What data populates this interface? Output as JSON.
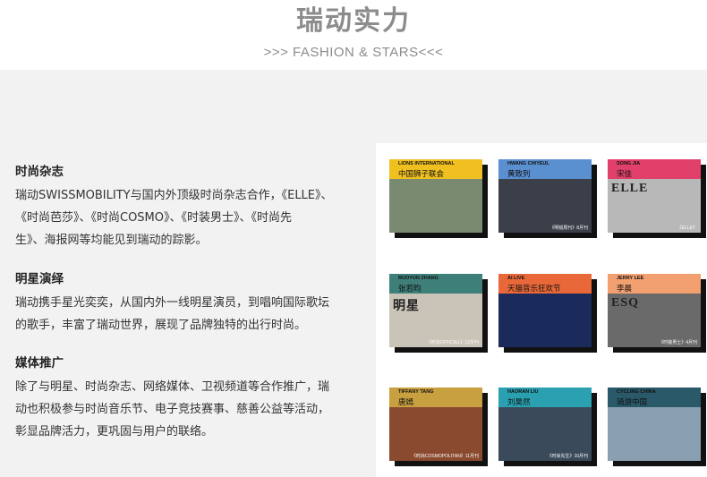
{
  "header": {
    "title": "瑞动实力",
    "subtitle": ">>>  FASHION & STARS<<<"
  },
  "sections": [
    {
      "heading": "时尚杂志",
      "lines": [
        "瑞动SWISSMOBILITY与国内外顶级时尚杂志合作，《ELLE》、",
        "《时尚芭莎》、《时尚COSMO》、《时装男士》、《时尚先",
        "生》、海报网等均能见到瑞动的踪影。"
      ]
    },
    {
      "heading": "明星演绎",
      "lines": [
        "瑞动携手星光奕奕，从国内外一线明星演员，到唱响国际歌坛",
        "的歌手，丰富了瑞动世界，展现了品牌独特的出行时尚。"
      ]
    },
    {
      "heading": "媒体推广",
      "lines": [
        "除了与明星、时尚杂志、网络媒体、卫视频道等合作推广，瑞",
        "动也积极参与时尚音乐节、电子竞技赛事、慈善公益等活动，",
        "彰显品牌活力，更巩固与用户的联络。"
      ]
    }
  ],
  "gallery": [
    {
      "en": "LIONS INTERNATIONAL",
      "cn": "中国狮子联会",
      "band_color": "#f0c020",
      "photo_color": "#7a8a70",
      "foot": "",
      "mag": ""
    },
    {
      "en": "HWANG CHIYEUL",
      "cn": "黄致列",
      "band_color": "#5a8fd0",
      "photo_color": "#3a3f4a",
      "foot": "《明锐周刊》8月刊",
      "mag": ""
    },
    {
      "en": "SONG JIA",
      "cn": "宋佳",
      "band_color": "#e0406a",
      "photo_color": "#b8b8b8",
      "foot": "《ELLE》",
      "mag": "ELLE"
    },
    {
      "en": "RUOYUN ZHANG",
      "cn": "张若昀",
      "band_color": "#3f7f7a",
      "photo_color": "#c9c3b8",
      "foot": "《时尚OFFICIEL》12月刊",
      "mag": "明星"
    },
    {
      "en": "AI LIVE",
      "cn": "天猫音乐狂欢节",
      "band_color": "#e8683a",
      "photo_color": "#1a2a5a",
      "foot": "",
      "mag": ""
    },
    {
      "en": "JERRY LEE",
      "cn": "李晨",
      "band_color": "#f2a070",
      "photo_color": "#6a6a6a",
      "foot": "《时装男士》4月刊",
      "mag": "ESQ"
    },
    {
      "en": "TIFFANY TANG",
      "cn": "唐嫣",
      "band_color": "#c8a040",
      "photo_color": "#8a4a30",
      "foot": "《时尚COSMOPOLITAN》11月刊",
      "mag": ""
    },
    {
      "en": "HAORAN LIU",
      "cn": "刘昊然",
      "band_color": "#2aa0b0",
      "photo_color": "#3a4a5a",
      "foot": "《时尚先生》10月刊",
      "mag": ""
    },
    {
      "en": "CYCLING CHINA",
      "cn": "骑游中国",
      "band_color": "#2a5a6a",
      "photo_color": "#8aa0b0",
      "foot": "",
      "mag": ""
    }
  ],
  "colors": {
    "title": "#8c8c8c",
    "panel_bg": "#f2f2f2",
    "card_shadow": "#111111"
  }
}
